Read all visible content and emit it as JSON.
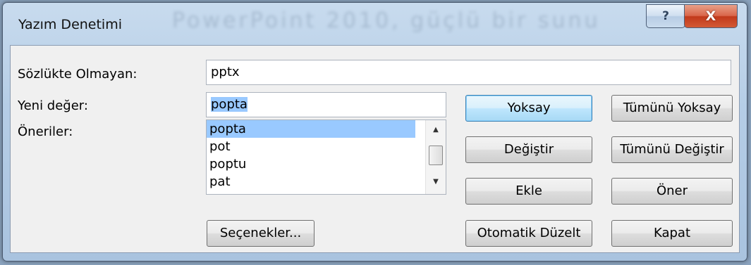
{
  "window": {
    "title": "Yazım Denetimi",
    "background_text": "PowerPoint 2010, güçlü bir sunu",
    "help_label": "?",
    "close_label": "X"
  },
  "form": {
    "not_in_dict_label": "Sözlükte Olmayan:",
    "not_in_dict_value": "pptx",
    "new_value_label": "Yeni değer:",
    "new_value_value": "popta",
    "suggestions_label": "Öneriler:",
    "suggestions": [
      "popta",
      "pot",
      "poptu",
      "pat"
    ]
  },
  "buttons": {
    "ignore": "Yoksay",
    "ignore_all": "Tümünü Yoksay",
    "change": "Değiştir",
    "change_all": "Tümünü Değiştir",
    "add": "Ekle",
    "suggest": "Öner",
    "options": "Seçenekler...",
    "autocorrect": "Otomatik Düzelt",
    "close": "Kapat"
  },
  "colors": {
    "selection": "#99c9ff",
    "default_button_border": "#3c7fb1",
    "close_button": "#c1391b"
  }
}
